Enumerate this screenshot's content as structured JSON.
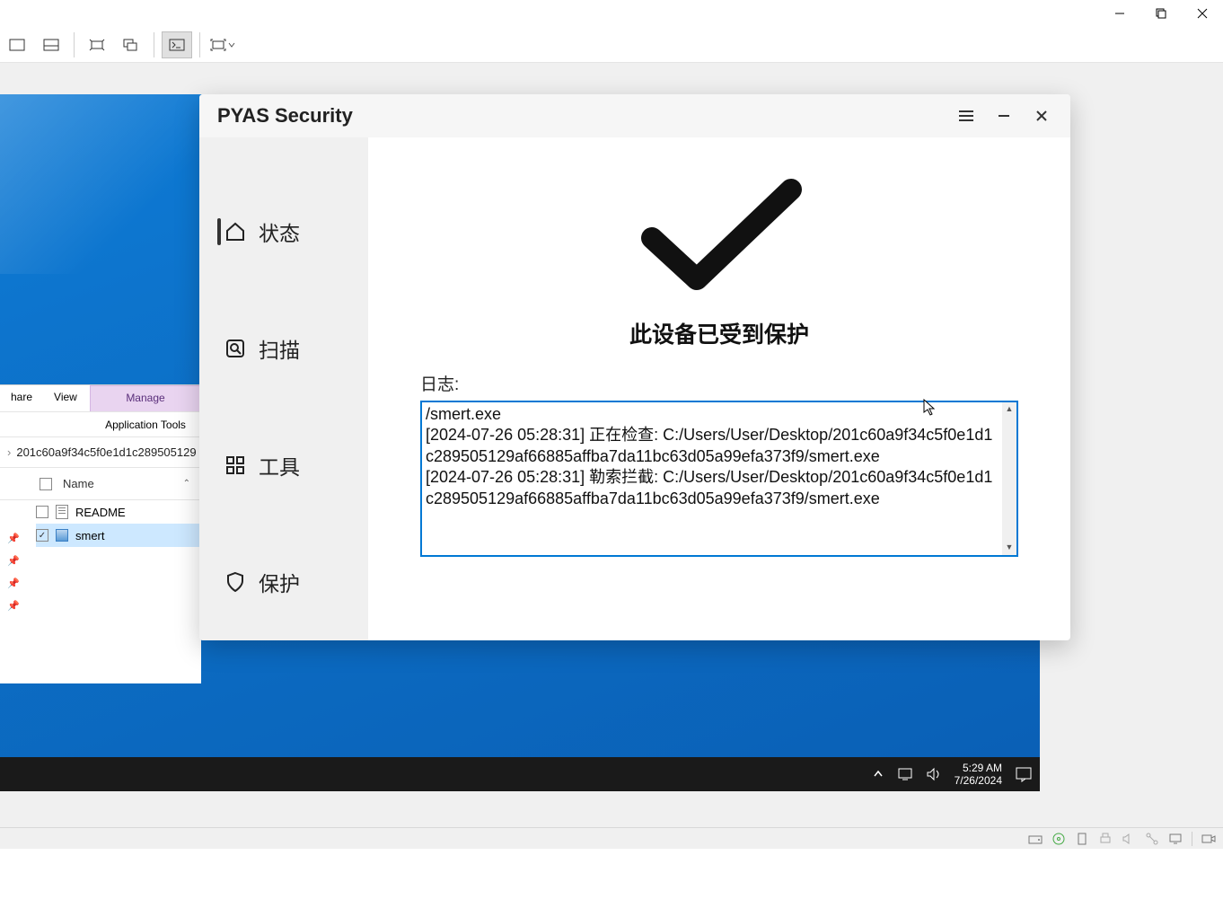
{
  "explorer": {
    "tabs": {
      "hare": "hare",
      "view": "View",
      "manage": "Manage",
      "apptools": "Application Tools"
    },
    "breadcrumb": "201c60a9f34c5f0e1d1c289505129",
    "column_name": "Name",
    "files": [
      {
        "name": "README",
        "checked": false,
        "selected": false,
        "icon": "txt"
      },
      {
        "name": "smert",
        "checked": true,
        "selected": true,
        "icon": "exe"
      }
    ]
  },
  "pyas": {
    "title": "PYAS Security",
    "nav": {
      "status": "状态",
      "scan": "扫描",
      "tools": "工具",
      "protect": "保护"
    },
    "status_text": "此设备已受到保护",
    "log_label": "日志:",
    "log_lines": "/smert.exe\n[2024-07-26 05:28:31] 正在检查: C:/Users/User/Desktop/201c60a9f34c5f0e1d1c289505129af66885affba7da11bc63d05a99efa373f9/smert.exe\n[2024-07-26 05:28:31] 勒索拦截: C:/Users/User/Desktop/201c60a9f34c5f0e1d1c289505129af66885affba7da11bc63d05a99efa373f9/smert.exe"
  },
  "taskbar": {
    "time": "5:29 AM",
    "date": "7/26/2024"
  }
}
